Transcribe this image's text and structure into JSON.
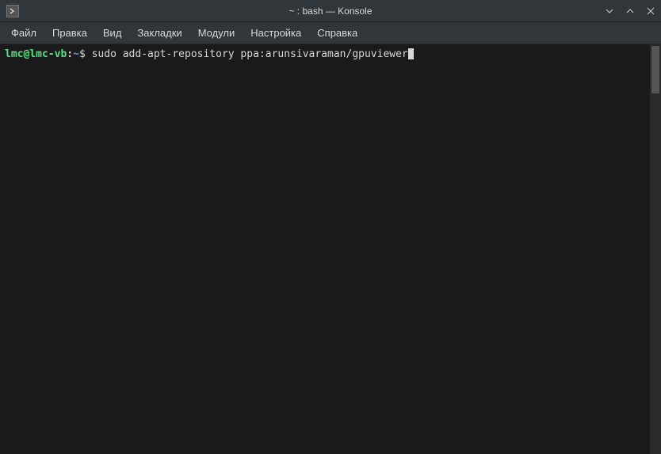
{
  "window": {
    "title": "~ : bash — Konsole"
  },
  "menubar": {
    "items": [
      {
        "label": "Файл"
      },
      {
        "label": "Правка"
      },
      {
        "label": "Вид"
      },
      {
        "label": "Закладки"
      },
      {
        "label": "Модули"
      },
      {
        "label": "Настройка"
      },
      {
        "label": "Справка"
      }
    ]
  },
  "terminal": {
    "prompt": {
      "user_host": "lmc@lmc-vb",
      "separator": ":",
      "path": "~",
      "symbol": "$"
    },
    "command": "sudo add-apt-repository ppa:arunsivaraman/gpuviewer"
  }
}
